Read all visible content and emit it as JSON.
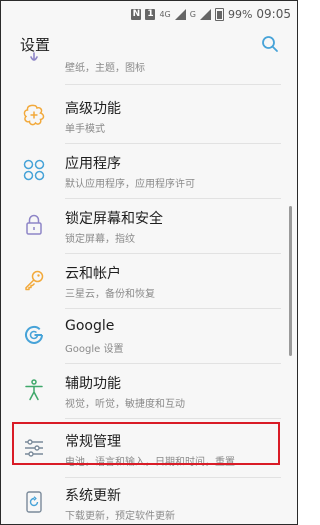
{
  "status_bar": {
    "n_label": "N",
    "badge_label": "1",
    "net_label": "4G",
    "g_label": "G",
    "battery": "99%",
    "time": "09:05"
  },
  "header": {
    "title": "设置"
  },
  "items": [
    {
      "label": "",
      "sub": "壁纸，主题，图标"
    },
    {
      "label": "高级功能",
      "sub": "单手模式"
    },
    {
      "label": "应用程序",
      "sub": "默认应用程序，应用程序许可"
    },
    {
      "label": "锁定屏幕和安全",
      "sub": "锁定屏幕，指纹"
    },
    {
      "label": "云和帐户",
      "sub": "三星云，备份和恢复"
    },
    {
      "label": "Google",
      "sub": "Google 设置"
    },
    {
      "label": "辅助功能",
      "sub": "视觉，听觉，敏捷度和互动"
    },
    {
      "label": "常规管理",
      "sub": "电池，语言和输入，日期和时间，重置"
    },
    {
      "label": "系统更新",
      "sub": "下载更新，预定软件更新"
    }
  ],
  "colors": {
    "icon_accent": "#f2a93b",
    "icon_blue": "#47a3d8",
    "icon_purple": "#8e85c7",
    "icon_gray": "#7a8a9a",
    "highlight_border": "#d91b26"
  }
}
